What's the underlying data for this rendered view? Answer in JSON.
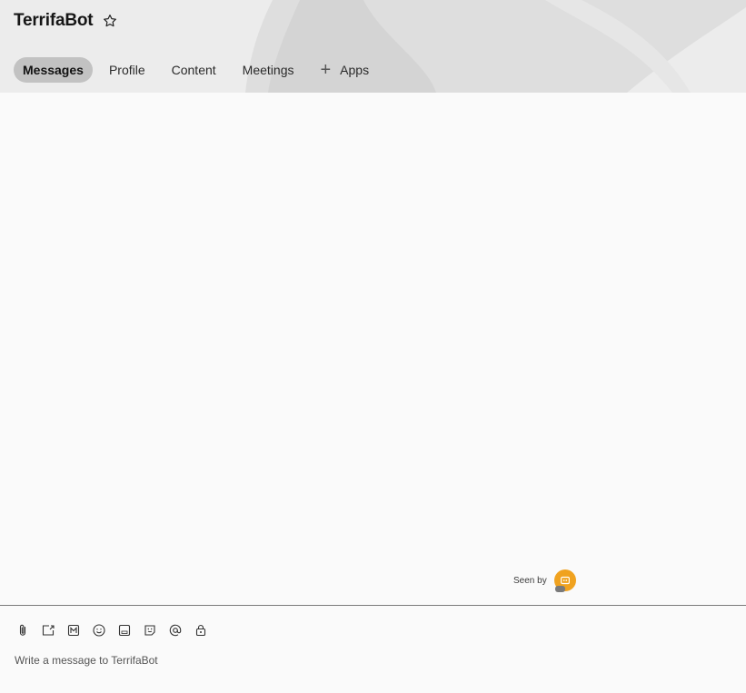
{
  "header": {
    "title": "TerrifaBot",
    "icons": {
      "favorite": "star-icon"
    }
  },
  "tabs": [
    {
      "label": "Messages",
      "active": true
    },
    {
      "label": "Profile",
      "active": false
    },
    {
      "label": "Content",
      "active": false
    },
    {
      "label": "Meetings",
      "active": false
    },
    {
      "label": "Apps",
      "active": false,
      "icon": "plus-icon"
    }
  ],
  "seen_by": {
    "label": "Seen by",
    "avatar_color": "#f0a21f"
  },
  "composer": {
    "placeholder": "Write a message to TerrifaBot",
    "value": "",
    "tools": [
      "paperclip-icon",
      "share-screen-icon",
      "markdown-icon",
      "emoji-icon",
      "gif-icon",
      "sticker-icon",
      "mention-icon",
      "lock-icon"
    ]
  },
  "colors": {
    "header_bg": "#ececec",
    "active_tab": "#c2c2c2",
    "page_bg": "#fafafa"
  }
}
